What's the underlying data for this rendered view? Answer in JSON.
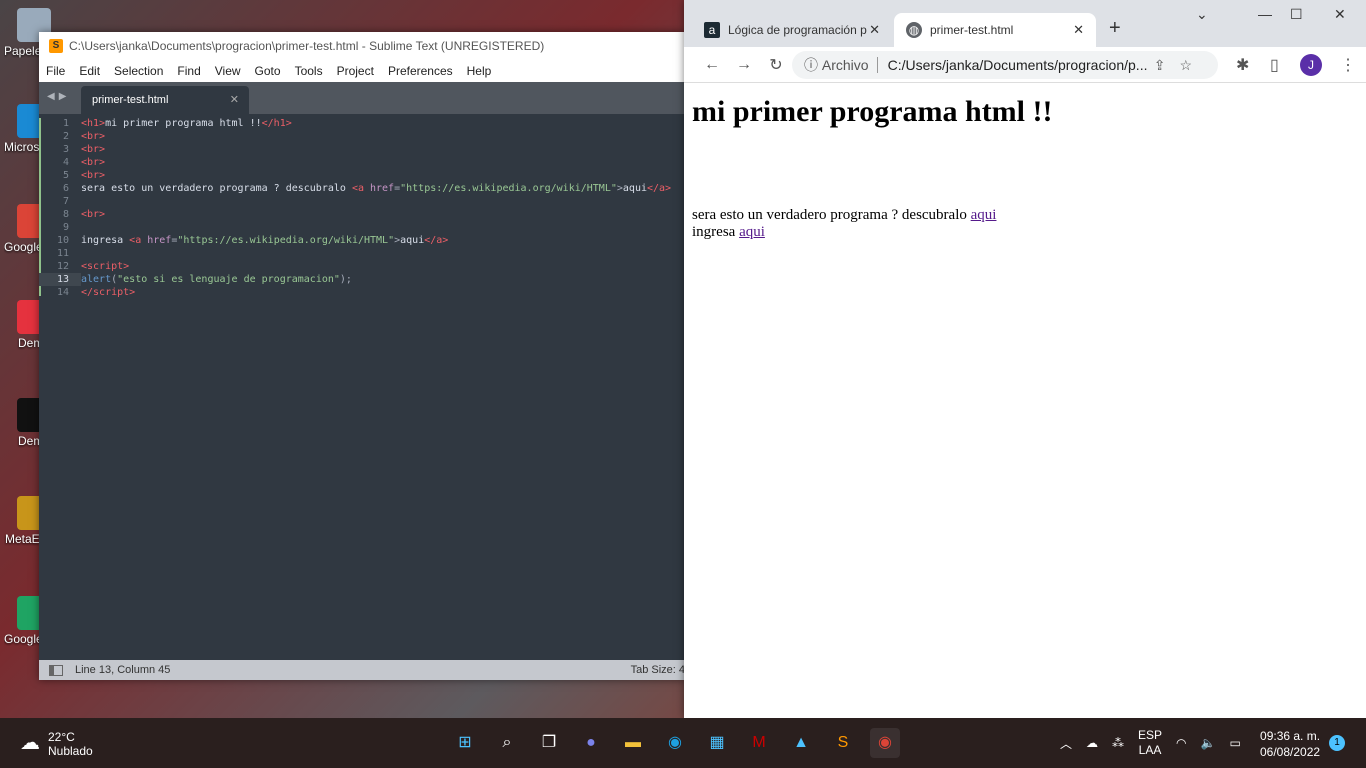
{
  "desktop": {
    "icons": [
      {
        "label": "Papelera de reciclaje",
        "color": "#9ab"
      },
      {
        "label": "Microsoft Edge",
        "color": "#1a8ad4"
      },
      {
        "label": "Google Chrome",
        "color": "#db4437"
      },
      {
        "label": "Demo",
        "color": "#e5323e"
      },
      {
        "label": "Demo",
        "color": "#111"
      },
      {
        "label": "MetaEditor",
        "color": "#c8951a"
      },
      {
        "label": "Google Drive",
        "color": "#1fa463"
      }
    ]
  },
  "sublime": {
    "title": "C:\\Users\\janka\\Documents\\progracion\\primer-test.html - Sublime Text (UNREGISTERED)",
    "menu": [
      "File",
      "Edit",
      "Selection",
      "Find",
      "View",
      "Goto",
      "Tools",
      "Project",
      "Preferences",
      "Help"
    ],
    "tab": "primer-test.html",
    "current_line": 13,
    "lines": [
      [
        [
          "tag",
          "<h1>"
        ],
        [
          "t",
          "mi primer programa html !!"
        ],
        [
          "tag",
          "</h1>"
        ]
      ],
      [
        [
          "tag",
          "<br>"
        ]
      ],
      [
        [
          "tag",
          "<br>"
        ]
      ],
      [
        [
          "tag",
          "<br>"
        ]
      ],
      [
        [
          "tag",
          "<br>"
        ]
      ],
      [
        [
          "t",
          "sera esto un verdadero programa ? descubralo "
        ],
        [
          "tag",
          "<a "
        ],
        [
          "a",
          "href"
        ],
        [
          "p",
          "="
        ],
        [
          "s",
          "\"https://es.wikipedia.org/wiki/HTML\""
        ],
        [
          "p",
          ">"
        ],
        [
          "t",
          "aqui"
        ],
        [
          "tag",
          "</a>"
        ]
      ],
      [],
      [
        [
          "tag",
          "<br>"
        ]
      ],
      [],
      [
        [
          "t",
          "ingresa "
        ],
        [
          "tag",
          "<a "
        ],
        [
          "a",
          "href"
        ],
        [
          "p",
          "="
        ],
        [
          "s",
          "\"https://es.wikipedia.org/wiki/HTML\""
        ],
        [
          "p",
          ">"
        ],
        [
          "t",
          "aqui"
        ],
        [
          "tag",
          "</a>"
        ]
      ],
      [],
      [
        [
          "tag",
          "<script>"
        ]
      ],
      [
        [
          "f",
          "alert"
        ],
        [
          "p",
          "("
        ],
        [
          "s",
          "\"esto si es lenguaje de programacion\""
        ],
        [
          "p",
          ");"
        ]
      ],
      [
        [
          "tag",
          "</script>"
        ]
      ]
    ],
    "status": "Line 13, Column 45",
    "tab_size": "Tab Size: 4"
  },
  "chrome": {
    "tabs": [
      {
        "title": "Lógica de programación p",
        "icon": "a"
      },
      {
        "title": "primer-test.html",
        "icon": "globe"
      }
    ],
    "security_label": "Archivo",
    "url": "C:/Users/janka/Documents/progracion/p...",
    "avatar": "J",
    "page": {
      "h1": "mi primer programa html !!",
      "line1": "sera esto un verdadero programa ? descubralo ",
      "link": "aqui",
      "line2": "ingresa "
    }
  },
  "taskbar": {
    "temp": "22°C",
    "weather": "Nublado",
    "lang1": "ESP",
    "lang2": "LAA",
    "time": "09:36 a. m.",
    "date": "06/08/2022",
    "notifications": "1"
  }
}
